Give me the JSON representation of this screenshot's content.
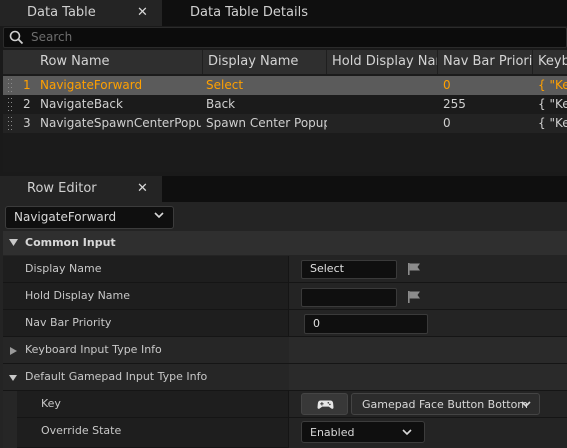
{
  "tabs": [
    {
      "label": "Data Table",
      "close": "✕",
      "active": true
    },
    {
      "label": "Data Table Details",
      "active": false
    }
  ],
  "search": {
    "placeholder": "Search"
  },
  "table": {
    "columns": [
      "Row Name",
      "Display Name",
      "Hold Display Name",
      "Nav Bar Priority",
      "Keybo"
    ],
    "rows": [
      {
        "index": "1",
        "name": "NavigateForward",
        "display": "Select",
        "hold": "",
        "priority": "0",
        "keyboard": "{ \"Key"
      },
      {
        "index": "2",
        "name": "NavigateBack",
        "display": "Back",
        "hold": "",
        "priority": "255",
        "keyboard": "{ \"Key"
      },
      {
        "index": "3",
        "name": "NavigateSpawnCenterPopup",
        "display": "Spawn Center Popup",
        "hold": "",
        "priority": "0",
        "keyboard": "{ \"Key"
      }
    ],
    "selected_row": 0
  },
  "row_editor": {
    "tab_label": "Row Editor",
    "close": "✕",
    "row_select": "NavigateForward",
    "section_title": "Common Input",
    "props": {
      "display_name": {
        "label": "Display Name",
        "value": "Select"
      },
      "hold_display_name": {
        "label": "Hold Display Name",
        "value": ""
      },
      "nav_bar_priority": {
        "label": "Nav Bar Priority",
        "value": "0"
      },
      "keyboard_info": {
        "label": "Keyboard Input Type Info"
      },
      "gamepad_info": {
        "label": "Default Gamepad Input Type Info"
      },
      "key": {
        "label": "Key",
        "value": "Gamepad Face Button Bottom",
        "icon": "gamepad-icon"
      },
      "override_state": {
        "label": "Override State",
        "value": "Enabled"
      }
    }
  },
  "colors": {
    "accent_selected_text": "#ffa000",
    "selected_row_bg": "#5b5b5b"
  }
}
